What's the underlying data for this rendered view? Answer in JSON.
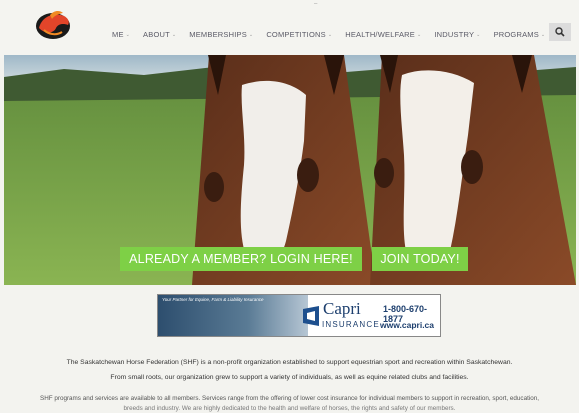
{
  "header": {
    "nav": [
      {
        "label": "ME",
        "has_caret": true
      },
      {
        "label": "ABOUT",
        "has_caret": true
      },
      {
        "label": "MEMBERSHIPS",
        "has_caret": true
      },
      {
        "label": "COMPETITIONS",
        "has_caret": true
      },
      {
        "label": "HEALTH/WELFARE",
        "has_caret": true
      },
      {
        "label": "INDUSTRY",
        "has_caret": true
      },
      {
        "label": "PROGRAMS",
        "has_caret": true
      }
    ],
    "search_icon": "search-icon",
    "top_marker": "–"
  },
  "hero": {
    "login_label": "ALREADY A MEMBER? LOGIN HERE!",
    "join_label": "JOIN TODAY!",
    "button_color": "#7ed046"
  },
  "ad": {
    "partner_text": "Your Partner for Equine, Farm & Liability Insurance",
    "brand": "Capri",
    "brand_sub": "INSURANCE",
    "phone": "1-800-670-1877",
    "url": "www.capri.ca"
  },
  "content": {
    "intro": "The Saskatchewan Horse Federation (SHF) is a non-profit organization established to support equestrian sport and recreation within Saskatchewan.",
    "growth": "From small roots, our organization grew to support a variety of individuals, as well as equine related clubs and facilities.",
    "programs": "SHF programs and services are available to all members. Services range from the offering of lower cost insurance for individual members to support in recreation, sport, education,",
    "programs_cont": "breeds and industry. We are highly dedicated to the health and welfare of horses, the rights and safety of our members."
  }
}
